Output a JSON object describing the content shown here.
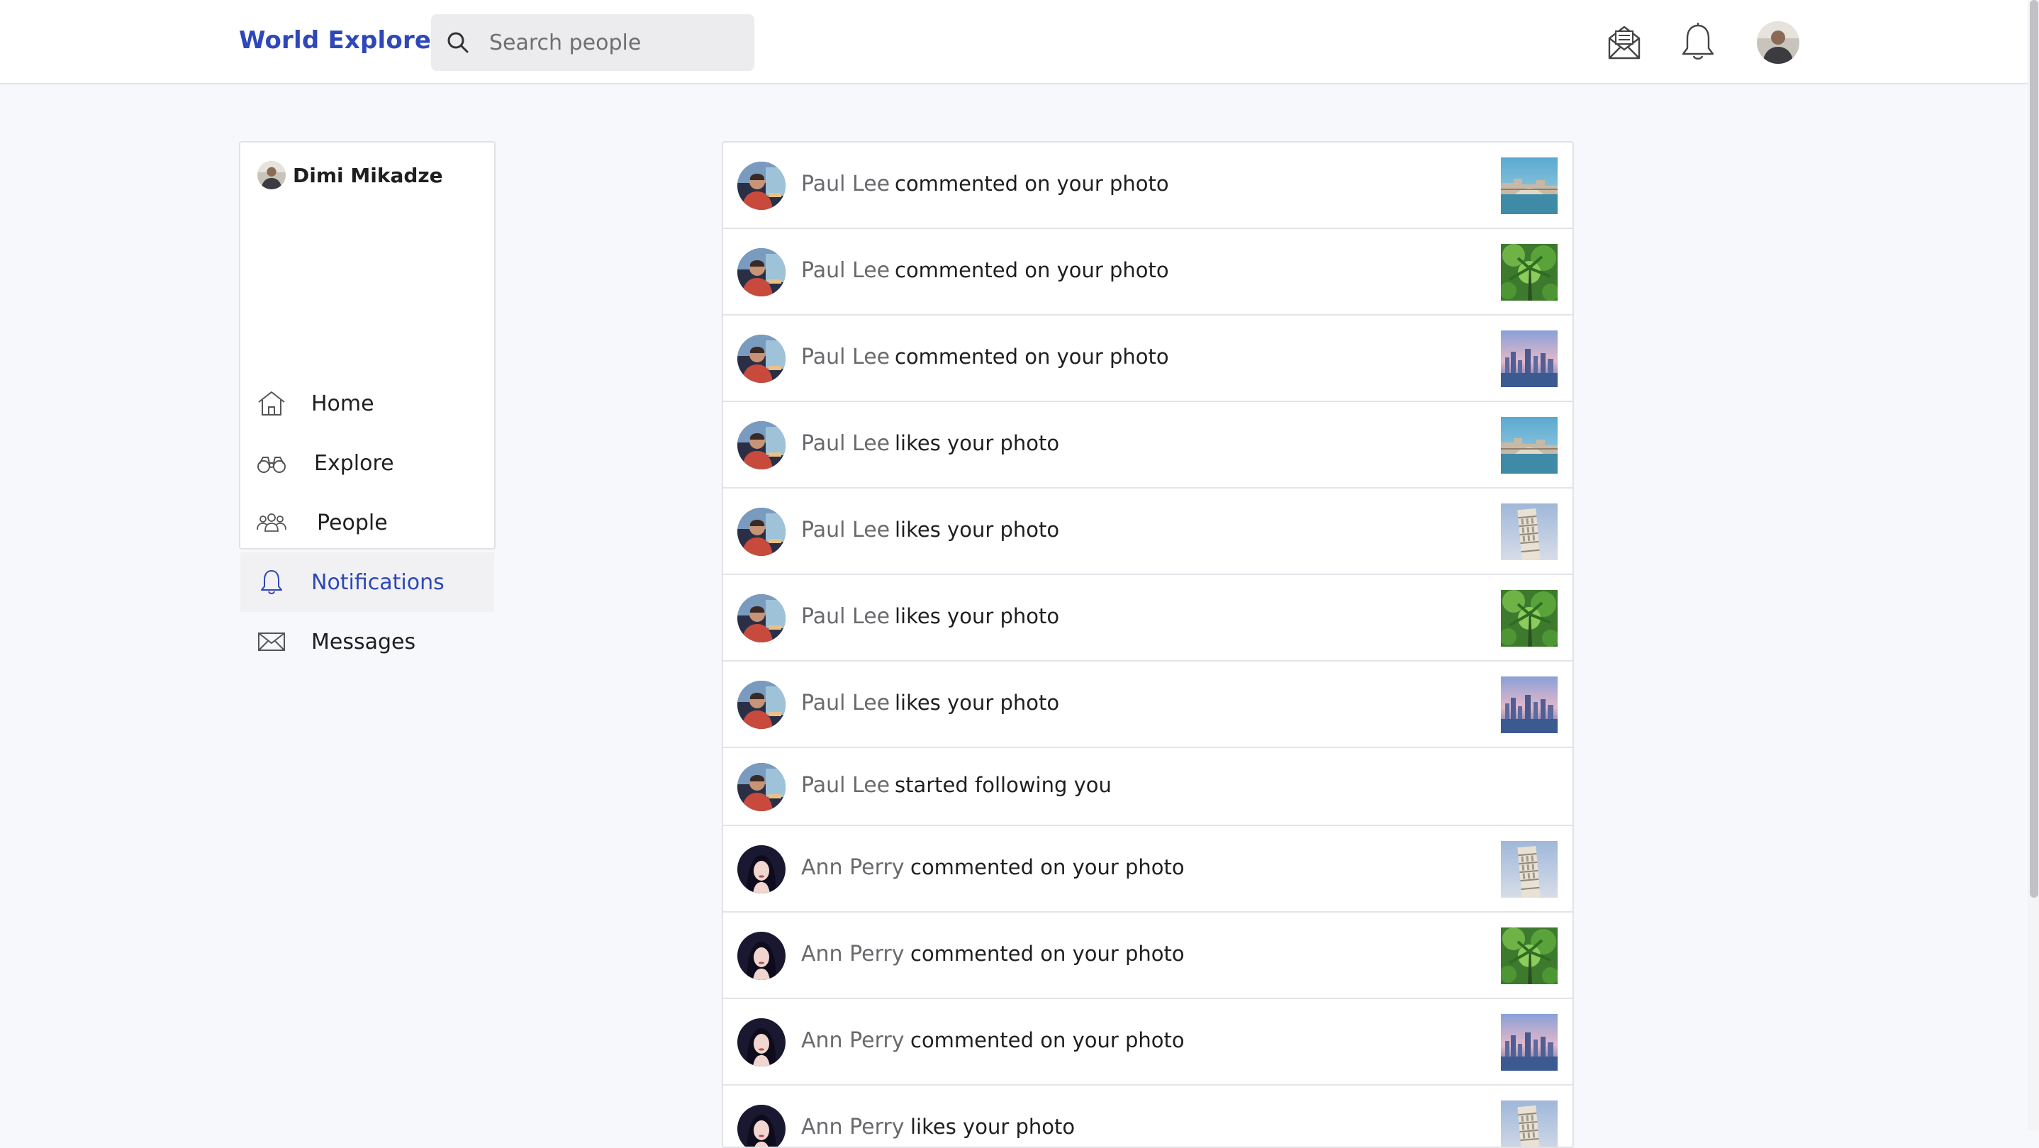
{
  "header": {
    "brand": "World Explorer",
    "search_placeholder": "Search people"
  },
  "sidebar": {
    "user_name": "Dimi Mikadze",
    "items": [
      {
        "label": "Home",
        "icon": "home-icon"
      },
      {
        "label": "Explore",
        "icon": "binoculars-icon"
      },
      {
        "label": "People",
        "icon": "people-icon"
      },
      {
        "label": "Notifications",
        "icon": "bell-icon",
        "active": true
      },
      {
        "label": "Messages",
        "icon": "envelope-icon"
      }
    ]
  },
  "notifications": [
    {
      "name": "Paul Lee",
      "text": "commented on your photo",
      "thumb": "venice"
    },
    {
      "name": "Paul Lee",
      "text": "commented on your photo",
      "thumb": "jungle"
    },
    {
      "name": "Paul Lee",
      "text": "commented on your photo",
      "thumb": "skyline"
    },
    {
      "name": "Paul Lee",
      "text": "likes your photo",
      "thumb": "venice"
    },
    {
      "name": "Paul Lee",
      "text": "likes your photo",
      "thumb": "pisa"
    },
    {
      "name": "Paul Lee",
      "text": "likes your photo",
      "thumb": "jungle"
    },
    {
      "name": "Paul Lee",
      "text": "likes your photo",
      "thumb": "skyline"
    },
    {
      "name": "Paul Lee",
      "text": "started following you",
      "thumb": null
    },
    {
      "name": "Ann Perry",
      "text": "commented on your photo",
      "thumb": "pisa"
    },
    {
      "name": "Ann Perry",
      "text": "commented on your photo",
      "thumb": "jungle"
    },
    {
      "name": "Ann Perry",
      "text": "commented on your photo",
      "thumb": "skyline"
    },
    {
      "name": "Ann Perry",
      "text": "likes your photo",
      "thumb": "pisa"
    }
  ],
  "colors": {
    "brand": "#2f47b8",
    "active_bg": "#f1f1f3",
    "page_bg": "#f7f8fb"
  }
}
